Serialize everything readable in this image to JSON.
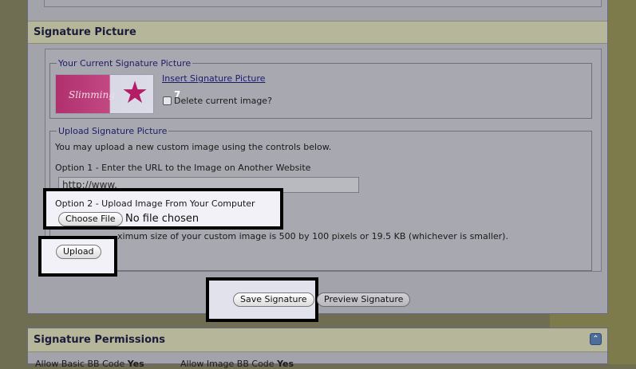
{
  "signature_picture": {
    "section_title": "Signature Picture",
    "current": {
      "legend": "Your Current Signature Picture",
      "image_text": "Slimming",
      "image_badge": "7",
      "insert_link": "Insert Signature Picture",
      "delete_label": "Delete current image?"
    },
    "upload": {
      "legend": "Upload Signature Picture",
      "intro": "You may upload a new custom image using the controls below.",
      "option1_label": "Option 1 - Enter the URL to the Image on Another Website",
      "url_value": "http://www.",
      "option2_label": "Option 2 - Upload Image From Your Computer",
      "choose_file_label": "Choose File",
      "no_file_text": "No file chosen",
      "note_visible": "ximum size of your custom image is 500 by 100 pixels or 19.5 KB (whichever is smaller).",
      "upload_button": "Upload"
    },
    "actions": {
      "save_button": "Save Signature",
      "preview_button": "Preview Signature"
    }
  },
  "permissions": {
    "section_title": "Signature Permissions",
    "collapse_icon": "⌃",
    "items": [
      {
        "label": "Allow Basic BB Code",
        "value": "Yes"
      },
      {
        "label": "Allow Image BB Code",
        "value": "Yes"
      }
    ]
  }
}
